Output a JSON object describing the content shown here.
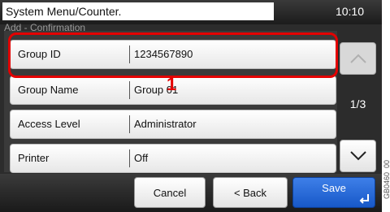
{
  "header": {
    "title": "System Menu/Counter.",
    "time": "10:10",
    "subtitle": "Add - Confirmation"
  },
  "rows": [
    {
      "label": "Group ID",
      "value": "1234567890"
    },
    {
      "label": "Group Name",
      "value": "Group 01"
    },
    {
      "label": "Access Level",
      "value": "Administrator"
    },
    {
      "label": "Printer",
      "value": "Off"
    }
  ],
  "annotation": {
    "number": "1"
  },
  "navigation": {
    "page_indicator": "1/3"
  },
  "buttons": {
    "cancel": "Cancel",
    "back": "< Back",
    "save": "Save"
  },
  "figure_code": "GB0460_00",
  "colors": {
    "highlight": "#e40000",
    "save_button": "#2a6ad6"
  }
}
